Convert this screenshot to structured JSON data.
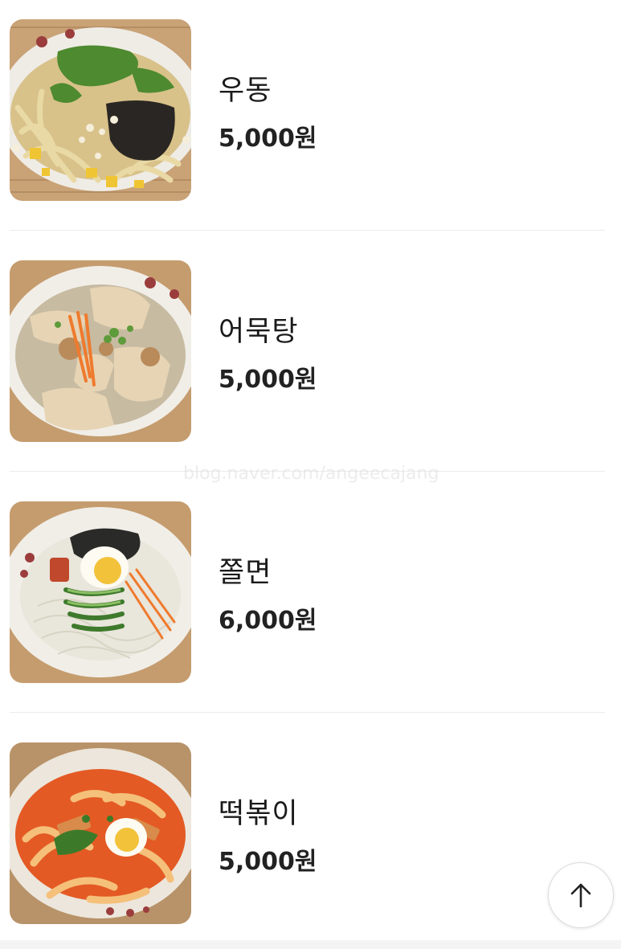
{
  "menu": {
    "items": [
      {
        "name": "우동",
        "price": "5,000원",
        "image": "udon-photo"
      },
      {
        "name": "어묵탕",
        "price": "5,000원",
        "image": "fishcake-soup-photo"
      },
      {
        "name": "쫄면",
        "price": "6,000원",
        "image": "jjolmyeon-photo"
      },
      {
        "name": "떡볶이",
        "price": "5,000원",
        "image": "tteokbokki-photo"
      }
    ]
  },
  "watermark": "blog.naver.com/angeecajang",
  "scroll_top": {
    "icon": "arrow-up-icon"
  },
  "colors": {
    "text": "#1a1a1a",
    "divider": "#ececec",
    "background": "#ffffff"
  }
}
